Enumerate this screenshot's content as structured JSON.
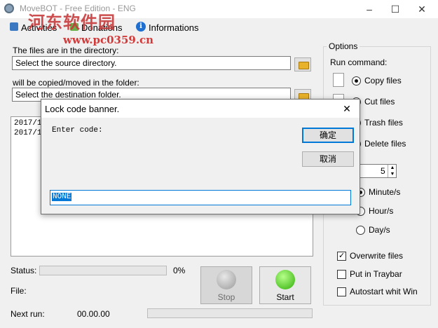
{
  "window": {
    "title": "MoveBOT - Free Edition - ENG",
    "watermark": "河东软件园",
    "watermark_url": "www.pc0359.cn"
  },
  "menu": {
    "activities": "Activities",
    "donations": "Donations",
    "informations": "Informations"
  },
  "source": {
    "label": "The files are in the directory:",
    "value": "Select the source directory."
  },
  "dest": {
    "label": "will be copied/moved in the folder:",
    "value": "Select the destination folder."
  },
  "log": {
    "lines": [
      "2017/1",
      "2017/1"
    ]
  },
  "options": {
    "title": "Options",
    "run_command": "Run command:",
    "copy": "Copy files",
    "cut": "Cut files",
    "trash": "Trash files",
    "delete": "Delete files",
    "interval_value": "5",
    "minutes": "Minute/s",
    "hours": "Hour/s",
    "days": "Day/s",
    "overwrite": "Overwrite files",
    "traybar": "Put in Traybar",
    "autostart": "Autostart whit Win"
  },
  "status": {
    "label": "Status:",
    "percent": "0%",
    "progress": 0,
    "file_label": "File:",
    "next_run_label": "Next run:",
    "next_run_value": "00.00.00"
  },
  "buttons": {
    "stop": "Stop",
    "start": "Start"
  },
  "dialog": {
    "title": "Lock code banner.",
    "prompt": "Enter code:",
    "ok": "确定",
    "cancel": "取消",
    "input_value": "NONE"
  },
  "colors": {
    "accent": "#0078d7",
    "start_green": "#4cd11c",
    "stop_gray": "#b9b9b9"
  }
}
